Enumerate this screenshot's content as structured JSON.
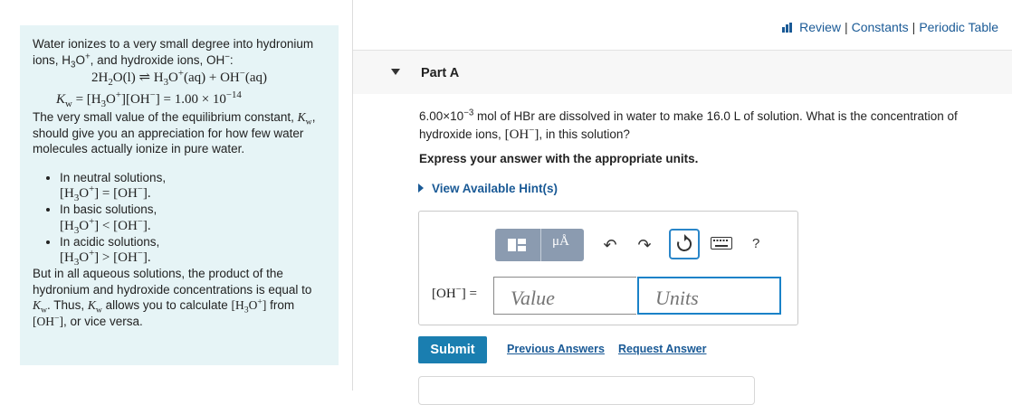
{
  "intro": {
    "p1": "Water ionizes to a very small degree into hydronium ions, H",
    "p1_b": "O",
    "p1_c": ", and hydroxide ions, OH",
    "p1_d": ":",
    "p2": "The very small value of the equilibrium constant,",
    "p2_b": ", should give you an appreciation for how few water molecules actually ionize in pure water.",
    "neutral": "In neutral solutions,",
    "basic": "In basic solutions,",
    "acidic": "In acidic solutions,",
    "p3": "But in all aqueous solutions, the product of the hydronium and hydroxide concentrations is equal to",
    "p3_b": ". Thus,",
    "p3_c": "allows you to calculate",
    "p3_d": "from",
    "p3_e": ", or vice versa.",
    "kw_value": "1.00 × 10",
    "kw_exp": "−14"
  },
  "links": {
    "review": "Review",
    "constants": "Constants",
    "periodic": "Periodic Table",
    "sep": "|"
  },
  "part": {
    "title": "Part A"
  },
  "question": {
    "amount": "6.00×10",
    "amount_exp": "−3",
    "text1": "mol of HBr are dissolved in water to make 16.0 L of solution. What is the concentration of hydroxide ions,",
    "text2": ", in this solution?",
    "instruction": "Express your answer with the appropriate units.",
    "hint": "View Available Hint(s)"
  },
  "answer": {
    "label": "[OH",
    "label_end": "] =",
    "value_placeholder": "Value",
    "units_placeholder": "Units",
    "help": "?",
    "mu": "μÅ"
  },
  "actions": {
    "submit": "Submit",
    "previous_answers": "Previous Answers",
    "request_answer": "Request Answer"
  },
  "colors": {
    "panel_bg": "#e6f4f6",
    "link": "#1a5a96",
    "submit": "#1a7eb0",
    "toolbar": "#8b9bb0",
    "focus": "#1a82c8"
  }
}
